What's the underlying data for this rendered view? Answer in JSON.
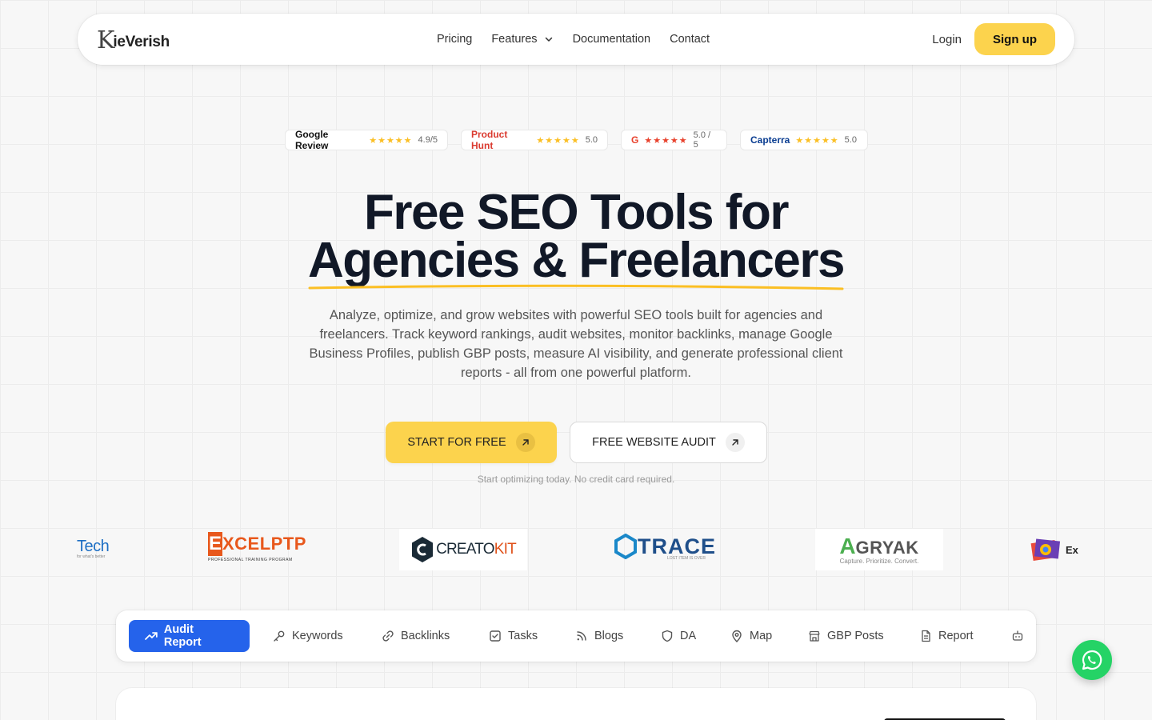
{
  "brand": {
    "logo_k": "K",
    "logo_rest": "ieVerish"
  },
  "nav": {
    "links": [
      "Pricing",
      "Features",
      "Documentation",
      "Contact"
    ],
    "login": "Login",
    "signup": "Sign up"
  },
  "badges": [
    {
      "name": "Google Review",
      "stars": "★★★★★",
      "score": "4.9/5",
      "color": "#111111"
    },
    {
      "name": "Product Hunt",
      "stars": "★★★★★",
      "score": "5.0",
      "color": "#da552f"
    },
    {
      "name": "G",
      "stars": "★★★★★",
      "score": "5.0 / 5",
      "color": "#ff492c"
    },
    {
      "name": "Capterra",
      "stars": "★★★★★",
      "score": "5.0",
      "color": "#044d80"
    }
  ],
  "hero": {
    "title_line1": "Free SEO Tools for",
    "title_line2": "Agencies & Freelancers",
    "description": "Analyze, optimize, and grow websites with powerful SEO tools built for agencies and freelancers. Track keyword rankings, audit websites, monitor backlinks, manage Google Business Profiles, publish GBP posts, measure AI visibility, and generate professional client reports - all from one powerful platform.",
    "cta_primary": "START FOR FREE",
    "cta_secondary": "FREE WEBSITE AUDIT",
    "fineprint": "Start optimizing today. No credit card required."
  },
  "client_logos": {
    "l1": "Tech",
    "l1_sub": "for what's better",
    "l2_main": "XCELPTP",
    "l2_first": "E",
    "l2_sub": "PROFESSIONAL TRAINING PROGRAM",
    "l3_a": "CREATO",
    "l3_b": "KIT",
    "l4": "TRACE",
    "l4_sub": "LOST ITEM IS OVER",
    "l5": "GRYAK",
    "l5_first": "A",
    "l5_sub": "Capture. Prioritize. Convert.",
    "l6": "Ex"
  },
  "tabs": [
    {
      "label": "Audit Report",
      "icon": "trending-up-icon"
    },
    {
      "label": "Keywords",
      "icon": "key-icon"
    },
    {
      "label": "Backlinks",
      "icon": "link-icon"
    },
    {
      "label": "Tasks",
      "icon": "checkbox-icon"
    },
    {
      "label": "Blogs",
      "icon": "rss-icon"
    },
    {
      "label": "DA",
      "icon": "shield-icon"
    },
    {
      "label": "Map",
      "icon": "map-pin-icon"
    },
    {
      "label": "GBP Posts",
      "icon": "store-icon"
    },
    {
      "label": "Report",
      "icon": "file-icon"
    }
  ],
  "colors": {
    "accent_yellow": "#fcd34d",
    "primary_blue": "#2563eb",
    "whatsapp_green": "#25d366"
  }
}
